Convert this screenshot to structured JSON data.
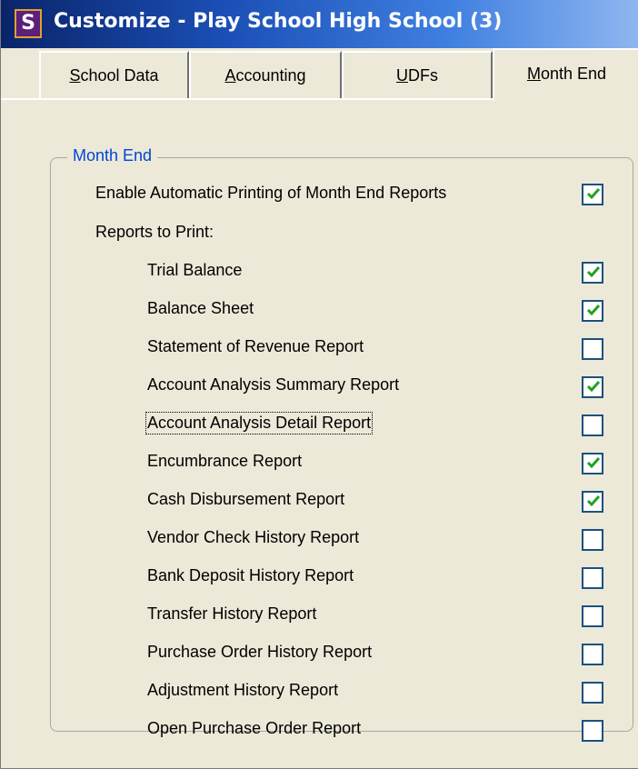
{
  "window": {
    "icon_letter": "S",
    "title": "Customize - Play School High School (3)"
  },
  "tabs": [
    {
      "pre": "",
      "u": "S",
      "post": "chool Data",
      "active": false
    },
    {
      "pre": "",
      "u": "A",
      "post": "ccounting",
      "active": false
    },
    {
      "pre": "",
      "u": "U",
      "post": "DFs",
      "active": false
    },
    {
      "pre": "",
      "u": "M",
      "post": "onth End",
      "active": true
    }
  ],
  "group": {
    "title": "Month End",
    "enable_label": "Enable Automatic Printing of Month End Reports",
    "enable_checked": true,
    "reports_heading": "Reports to Print:",
    "reports": [
      {
        "label": "Trial Balance",
        "checked": true
      },
      {
        "label": "Balance Sheet",
        "checked": true
      },
      {
        "label": "Statement of Revenue Report",
        "checked": false
      },
      {
        "label": "Account Analysis Summary Report",
        "checked": true
      },
      {
        "label": "Account Analysis Detail Report",
        "checked": false,
        "focused": true
      },
      {
        "label": "Encumbrance Report",
        "checked": true
      },
      {
        "label": "Cash Disbursement Report",
        "checked": true
      },
      {
        "label": "Vendor Check History Report",
        "checked": false
      },
      {
        "label": "Bank Deposit History Report",
        "checked": false
      },
      {
        "label": "Transfer History Report",
        "checked": false
      },
      {
        "label": "Purchase Order History Report",
        "checked": false
      },
      {
        "label": "Adjustment History Report",
        "checked": false
      },
      {
        "label": "Open Purchase Order Report",
        "checked": false
      }
    ]
  },
  "colors": {
    "check_mark": "#21a121",
    "group_title": "#0046d5",
    "checkbox_border": "#1c5180"
  }
}
